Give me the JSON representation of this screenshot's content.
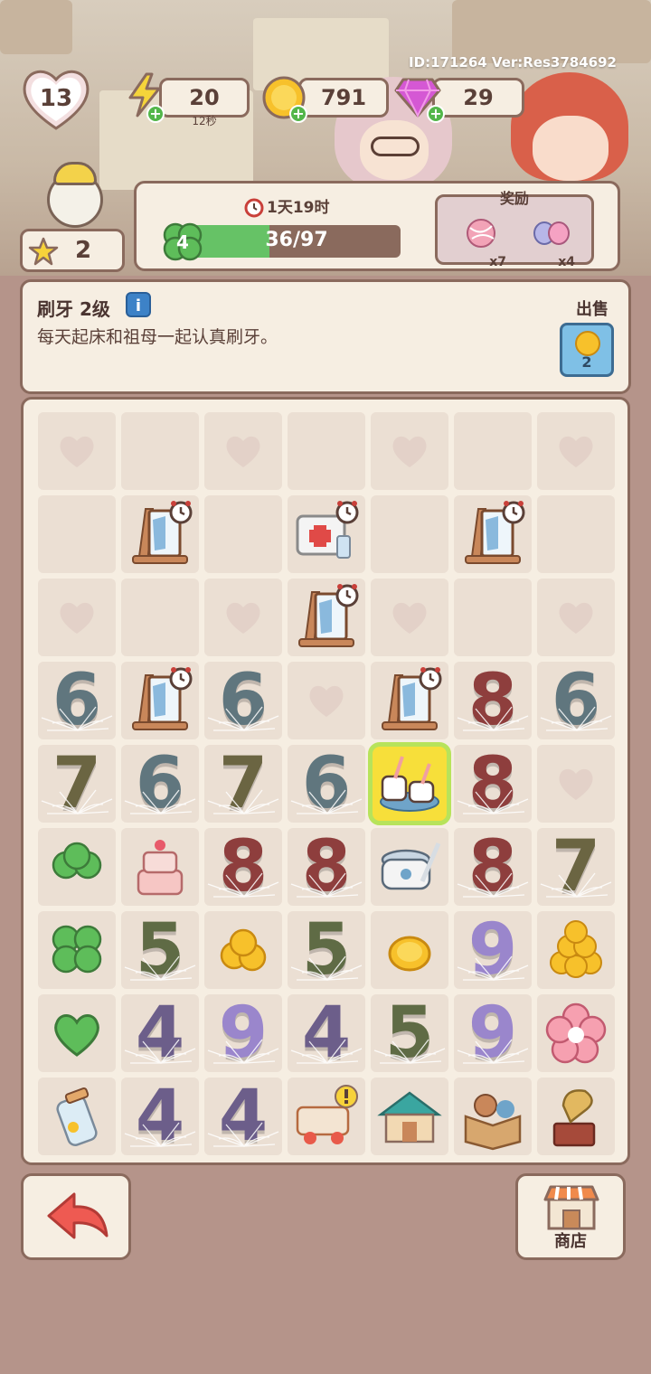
{
  "header": {
    "id_version": "ID:171264  Ver:Res3784692",
    "level": "13",
    "energy": {
      "value": "20",
      "timer": "12秒",
      "icon": "lightning-icon"
    },
    "coins": {
      "value": "791",
      "icon": "coin-icon"
    },
    "gems": {
      "value": "29",
      "icon": "gem-icon"
    },
    "stars": {
      "value": "2",
      "icon": "star-icon"
    }
  },
  "quest": {
    "timer": "1天19时",
    "clover_level": "4",
    "progress_text": "36/97",
    "progress_fraction": 0.371,
    "reward_title": "奖励",
    "rewards": [
      {
        "icon": "yarn-ball-icon",
        "count": "x7"
      },
      {
        "icon": "candy-icon",
        "count": "x4"
      }
    ]
  },
  "item_info": {
    "name": "刷牙 2级",
    "description": "每天起床和祖母一起认真刷牙。",
    "sell_label": "出售",
    "sell_price": "2"
  },
  "board": {
    "rows": [
      [
        "heart",
        "empty",
        "heart",
        "empty",
        "heart",
        "empty",
        "heart"
      ],
      [
        "empty",
        "easel",
        "empty",
        "firstaid",
        "empty",
        "easel",
        "empty"
      ],
      [
        "heart",
        "empty",
        "heart",
        "easel",
        "heart",
        "empty",
        "heart"
      ],
      [
        "6",
        "easel",
        "6",
        "heart",
        "easel",
        "8",
        "6"
      ],
      [
        "7",
        "6",
        "7",
        "6",
        "cups",
        "8",
        "heart"
      ],
      [
        "clover-small",
        "cake",
        "8",
        "8",
        "ricecooker",
        "8",
        "7"
      ],
      [
        "clover",
        "5",
        "coins-small",
        "5",
        "coin-single",
        "9",
        "coins-big"
      ],
      [
        "heart-green",
        "4",
        "9",
        "4",
        "5",
        "9",
        "flower"
      ],
      [
        "jar",
        "4",
        "4",
        "toycart",
        "house",
        "box",
        "gramophone"
      ]
    ],
    "selected": [
      4,
      4
    ],
    "digit_colors": {
      "4": "#6c5e8a",
      "5": "#5f6b45",
      "6": "#60767e",
      "7": "#6b6542",
      "8": "#8e3e3d",
      "9": "#9a86cc"
    }
  },
  "buttons": {
    "shop_label": "商店"
  }
}
